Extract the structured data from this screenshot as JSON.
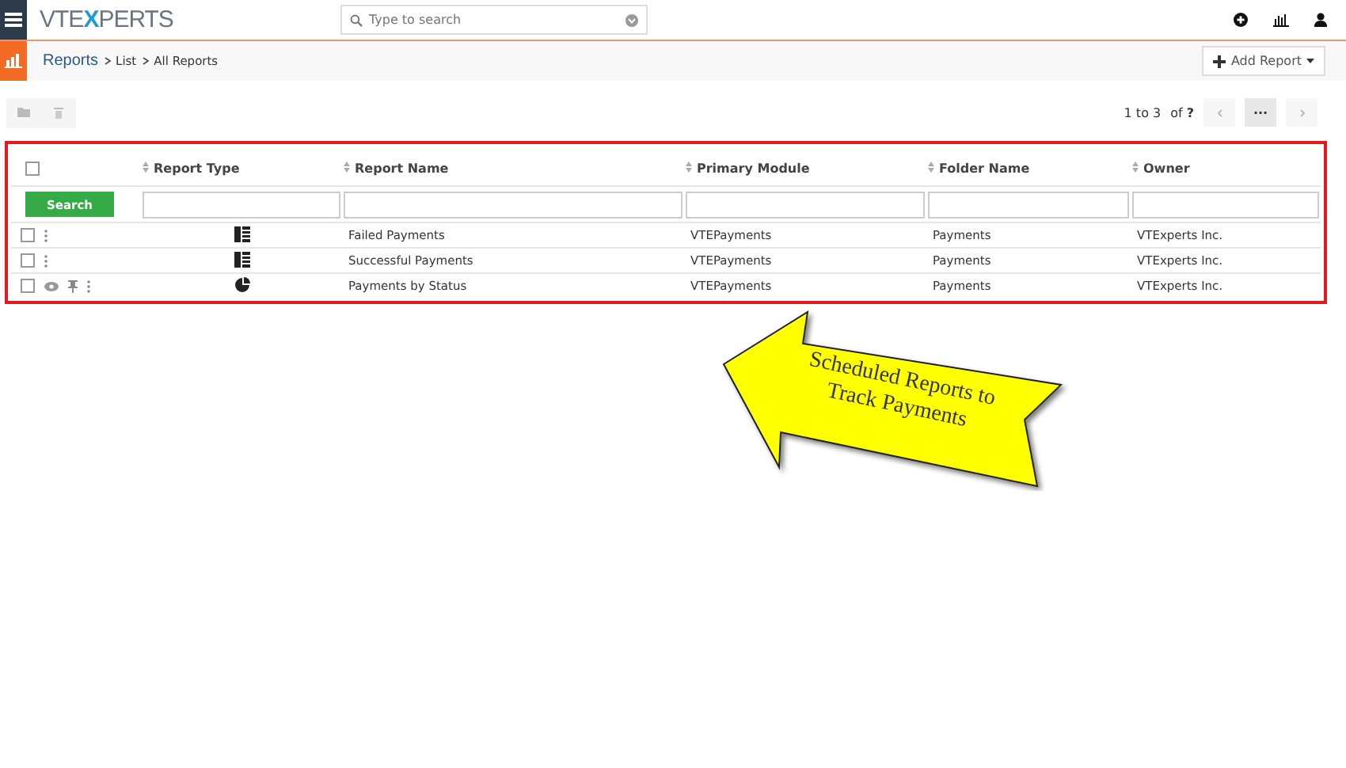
{
  "topbar": {
    "logo_left": "VTE",
    "logo_x": "X",
    "logo_right": "PERTS",
    "search": {
      "placeholder": "Type to search"
    }
  },
  "breadcrumb": {
    "module": "Reports",
    "path": [
      "List",
      "All Reports"
    ],
    "add_button": "Add Report"
  },
  "pagination": {
    "range": "1 to 3",
    "of": "of",
    "total": "?",
    "more": "···"
  },
  "table": {
    "select_all_checked": false,
    "columns": [
      "Report Type",
      "Report Name",
      "Primary Module",
      "Folder Name",
      "Owner"
    ],
    "search_button": "Search",
    "rows": [
      {
        "checked": false,
        "preview": false,
        "report_type": {
          "kind": "tabular"
        },
        "report_name": "Failed Payments",
        "primary_module": "VTEPayments",
        "folder_name": "Payments",
        "owner": "VTExperts Inc."
      },
      {
        "checked": false,
        "preview": false,
        "report_type": {
          "kind": "tabular"
        },
        "report_name": "Successful Payments",
        "primary_module": "VTEPayments",
        "folder_name": "Payments",
        "owner": "VTExperts Inc."
      },
      {
        "checked": false,
        "preview": true,
        "report_type": {
          "kind": "chart"
        },
        "report_name": "Payments by Status",
        "primary_module": "VTEPayments",
        "folder_name": "Payments",
        "owner": "VTExperts Inc."
      }
    ]
  },
  "callout": {
    "lines": [
      "Scheduled Reports to",
      "Track Payments"
    ]
  }
}
